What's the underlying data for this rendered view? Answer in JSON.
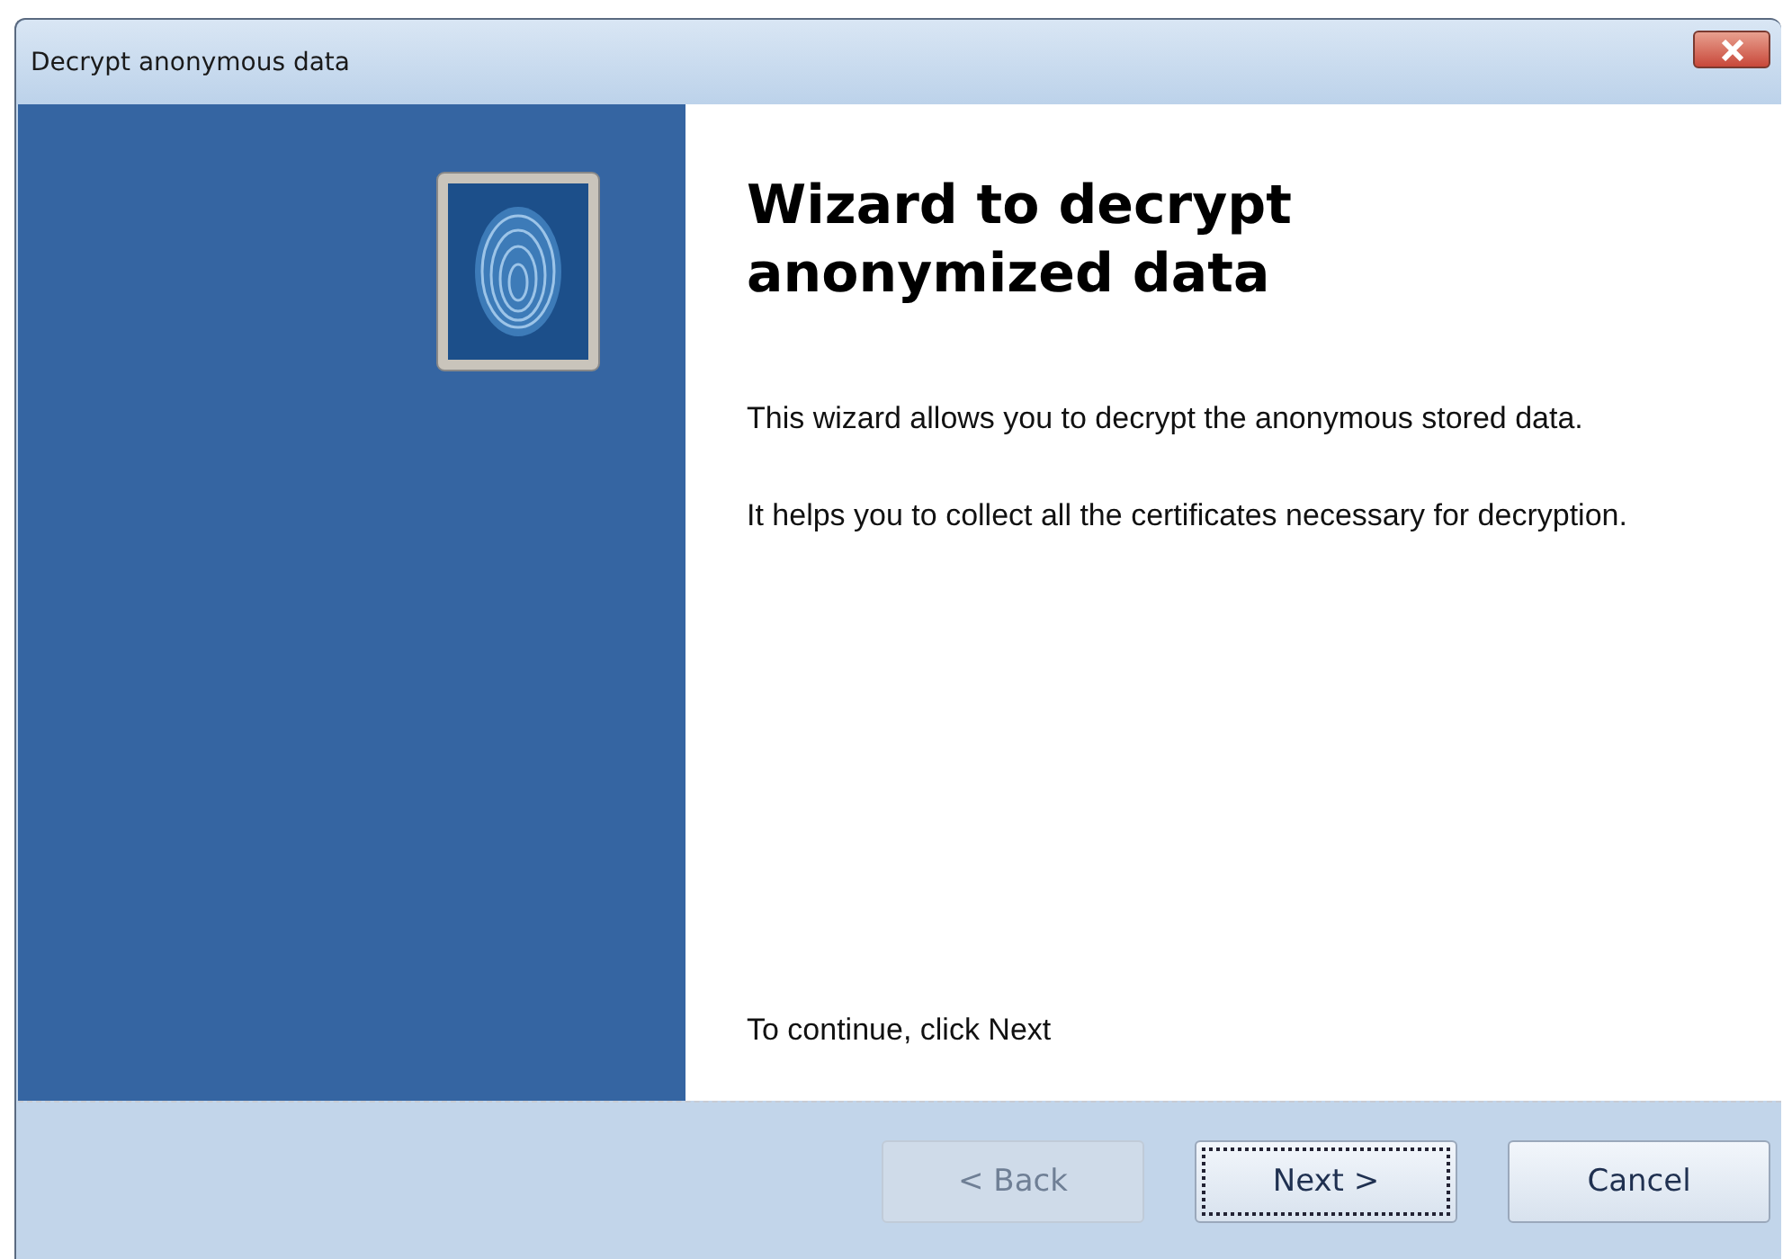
{
  "window": {
    "title": "Decrypt anonymous data"
  },
  "heading": "Wizard to decrypt anonymized data",
  "paragraphs": [
    "This wizard allows you to decrypt the anonymous stored data.",
    "It helps you to collect all the certificates necessary for decryption."
  ],
  "instruction": "To continue, click Next",
  "buttons": [
    {
      "label": "< Back",
      "disabled": true,
      "focused": false
    },
    {
      "label": "Next >",
      "disabled": false,
      "focused": true
    },
    {
      "label": "Cancel",
      "disabled": false,
      "focused": false
    }
  ]
}
